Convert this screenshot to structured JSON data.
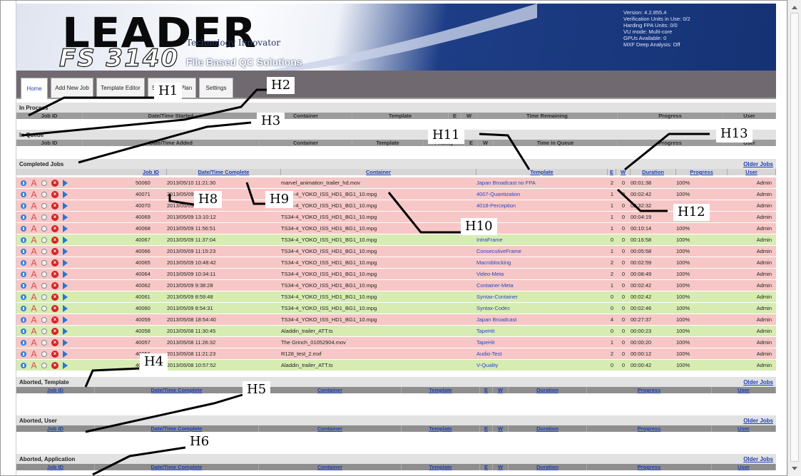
{
  "header": {
    "logo_text": "LEADER",
    "product_text": "FS 3140",
    "tagline": "Technology Innovator",
    "subtitle": "File Based QC Solutions",
    "system_info": [
      "Version: 4.2.855.4",
      "Verification Units in Use: 0/2",
      "Harding FPA Units: 0/0",
      "VU mode: Multi-core",
      "GPUs Available: 0",
      "MXF Deep Analysis: Off"
    ]
  },
  "tabs": [
    {
      "label": "Home",
      "active": true
    },
    {
      "label": "Add New Job",
      "active": false
    },
    {
      "label": "Template Editor",
      "active": false
    },
    {
      "label": "Smart Test Plan",
      "active": false
    },
    {
      "label": "Settings",
      "active": false
    }
  ],
  "in_process": {
    "title": "In Process",
    "columns": [
      "Job ID",
      "Date/Time Started",
      "Container",
      "Template",
      "E",
      "W",
      "Time Remaining",
      "Progress",
      "User"
    ]
  },
  "in_queue": {
    "title": "In Queue",
    "columns": [
      "Job ID",
      "Date/Time Added",
      "Container",
      "Template",
      "Priority",
      "E",
      "W",
      "Time in Queue",
      "Progress",
      "User"
    ]
  },
  "completed": {
    "title": "Completed Jobs",
    "older_link": "Older Jobs",
    "columns": [
      "Job ID",
      "Date/Time Complete",
      "Container",
      "Template",
      "E",
      "W",
      "Duration",
      "Progress",
      "User"
    ],
    "rows": [
      {
        "id": "50060",
        "dt": "2013/05/10 11:21:30",
        "container": "marvel_animation_trailer_hd.mov",
        "template": "Japan Broadcast no FPA",
        "e": "2",
        "w": "0",
        "duration": "00:01:38",
        "progress": "100%",
        "user": "Admin",
        "status": "red"
      },
      {
        "id": "40071",
        "dt": "2013/05/09 13:37:15",
        "container": "TS34-4_YOKO_ISS_HD1_BG1_10.mpg",
        "template": "4007-Quantization",
        "e": "1",
        "w": "0",
        "duration": "00:02:42",
        "progress": "100%",
        "user": "Admin",
        "status": "red"
      },
      {
        "id": "40070",
        "dt": "2013/05/09 13:26:12",
        "container": "TS34-4_YOKO_ISS_HD1_BG1_10.mpg",
        "template": "4018-Perception",
        "e": "1",
        "w": "0",
        "duration": "02:32:32",
        "progress": "100%",
        "user": "Admin",
        "status": "red"
      },
      {
        "id": "40069",
        "dt": "2013/05/09 13:10:12",
        "container": "TS34-4_YOKO_ISS_HD1_BG1_10.mpg",
        "template": "",
        "e": "1",
        "w": "0",
        "duration": "00:04:19",
        "progress": "100%",
        "user": "Admin",
        "status": "red"
      },
      {
        "id": "40068",
        "dt": "2013/05/09 11:56:51",
        "container": "TS34-4_YOKO_ISS_HD1_BG1_10.mpg",
        "template": "",
        "e": "1",
        "w": "0",
        "duration": "00:10:14",
        "progress": "100%",
        "user": "Admin",
        "status": "red"
      },
      {
        "id": "40067",
        "dt": "2013/05/09 11:37:04",
        "container": "TS34-4_YOKO_ISS_HD1_BG1_10.mpg",
        "template": "IntraFrame",
        "e": "0",
        "w": "0",
        "duration": "00:16:58",
        "progress": "100%",
        "user": "Admin",
        "status": "green"
      },
      {
        "id": "40066",
        "dt": "2013/05/09 11:15:23",
        "container": "TS34-4_YOKO_ISS_HD1_BG1_10.mpg",
        "template": "ConsecutiveFrame",
        "e": "1",
        "w": "0",
        "duration": "00:05:58",
        "progress": "100%",
        "user": "Admin",
        "status": "red"
      },
      {
        "id": "40065",
        "dt": "2013/05/09 10:48:42",
        "container": "TS34-4_YOKO_ISS_HD1_BG1_10.mpg",
        "template": "Macroblocking",
        "e": "2",
        "w": "0",
        "duration": "00:02:59",
        "progress": "100%",
        "user": "Admin",
        "status": "red"
      },
      {
        "id": "40064",
        "dt": "2013/05/09 10:34:11",
        "container": "TS34-4_YOKO_ISS_HD1_BG1_10.mpg",
        "template": "Video-Meta",
        "e": "2",
        "w": "0",
        "duration": "00:08:49",
        "progress": "100%",
        "user": "Admin",
        "status": "red"
      },
      {
        "id": "40062",
        "dt": "2013/05/09 9:38:28",
        "container": "TS34-4_YOKO_ISS_HD1_BG1_10.mpg",
        "template": "Container-Meta",
        "e": "1",
        "w": "0",
        "duration": "00:02:42",
        "progress": "100%",
        "user": "Admin",
        "status": "red"
      },
      {
        "id": "40061",
        "dt": "2013/05/09 8:59:48",
        "container": "TS34-4_YOKO_ISS_HD1_BG1_10.mpg",
        "template": "Syntax-Container",
        "e": "0",
        "w": "0",
        "duration": "00:02:42",
        "progress": "100%",
        "user": "Admin",
        "status": "green"
      },
      {
        "id": "40060",
        "dt": "2013/05/09 8:54:31",
        "container": "TS34-4_YOKO_ISS_HD1_BG1_10.mpg",
        "template": "Syntax-Codec",
        "e": "0",
        "w": "0",
        "duration": "00:02:46",
        "progress": "100%",
        "user": "Admin",
        "status": "green"
      },
      {
        "id": "40059",
        "dt": "2013/05/08 18:54:40",
        "container": "TS34-4_YOKO_ISS_HD1_BG1_10.mpg",
        "template": "Japan Broadcast",
        "e": "4",
        "w": "0",
        "duration": "00:27:37",
        "progress": "100%",
        "user": "Admin",
        "status": "red"
      },
      {
        "id": "40058",
        "dt": "2013/05/08 11:30:45",
        "container": "Aladdin_trailer_ATT.ts",
        "template": "TapeHit",
        "e": "0",
        "w": "0",
        "duration": "00:00:23",
        "progress": "100%",
        "user": "Admin",
        "status": "green"
      },
      {
        "id": "40057",
        "dt": "2013/05/08 11:26:32",
        "container": "The Grinch_01052904.mov",
        "template": "TapeHit",
        "e": "1",
        "w": "0",
        "duration": "00:00:20",
        "progress": "100%",
        "user": "Admin",
        "status": "red"
      },
      {
        "id": "40056",
        "dt": "2013/05/08 11:21:23",
        "container": "R128_test_2.mxf",
        "template": "Audio-Test",
        "e": "2",
        "w": "0",
        "duration": "00:00:12",
        "progress": "100%",
        "user": "Admin",
        "status": "red"
      },
      {
        "id": "40055",
        "dt": "2013/05/08 10:57:52",
        "container": "Aladdin_trailer_ATT.ts",
        "template": "V-Quality",
        "e": "0",
        "w": "0",
        "duration": "00:00:42",
        "progress": "100%",
        "user": "Admin",
        "status": "green"
      }
    ]
  },
  "aborted_template": {
    "title": "Aborted, Template",
    "older_link": "Older Jobs",
    "columns": [
      "Job ID",
      "Date/Time Complete",
      "Container",
      "Template",
      "E",
      "W",
      "Duration",
      "Progress",
      "User"
    ]
  },
  "aborted_user": {
    "title": "Aborted, User",
    "older_link": "Older Jobs",
    "columns": [
      "Job ID",
      "Date/Time Complete",
      "Container",
      "Template",
      "E",
      "W",
      "Duration",
      "Progress",
      "User"
    ]
  },
  "aborted_application": {
    "title": "Aborted, Application",
    "older_link": "Older Jobs",
    "columns": [
      "Job ID",
      "Date/Time Complete",
      "Container",
      "Template",
      "E",
      "W",
      "Duration",
      "Progress",
      "User"
    ]
  },
  "callouts": [
    "H1",
    "H2",
    "H3",
    "H4",
    "H5",
    "H6",
    "H8",
    "H9",
    "H10",
    "H11",
    "H12",
    "H13"
  ],
  "colors": {
    "failed_row": "#f6c7c6",
    "passed_row": "#d7ecb2",
    "link": "#1f3fb5",
    "nav_bar": "#706a70"
  },
  "icons": [
    "info-icon",
    "pdf-report-icon",
    "rerun-icon",
    "delete-icon",
    "play-icon"
  ]
}
